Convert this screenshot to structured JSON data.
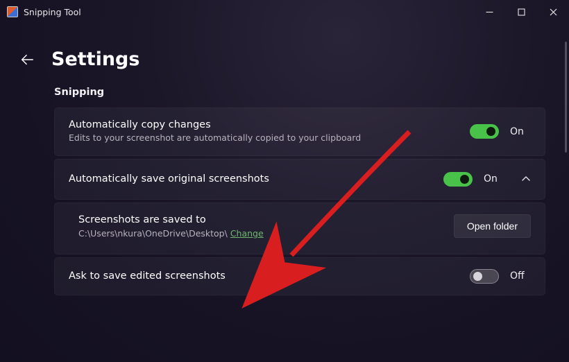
{
  "window": {
    "title": "Snipping Tool"
  },
  "header": {
    "page_title": "Settings"
  },
  "section": {
    "label": "Snipping"
  },
  "settings": {
    "copy_changes": {
      "title": "Automatically copy changes",
      "subtitle": "Edits to your screenshot are automatically copied to your clipboard",
      "state_label": "On"
    },
    "auto_save": {
      "title": "Automatically save original screenshots",
      "state_label": "On"
    },
    "save_location": {
      "title": "Screenshots are saved to",
      "path": "C:\\Users\\nkura\\OneDrive\\Desktop\\",
      "change_label": "Change",
      "open_folder_label": "Open folder"
    },
    "ask_save_edited": {
      "title": "Ask to save edited screenshots",
      "state_label": "Off"
    }
  }
}
